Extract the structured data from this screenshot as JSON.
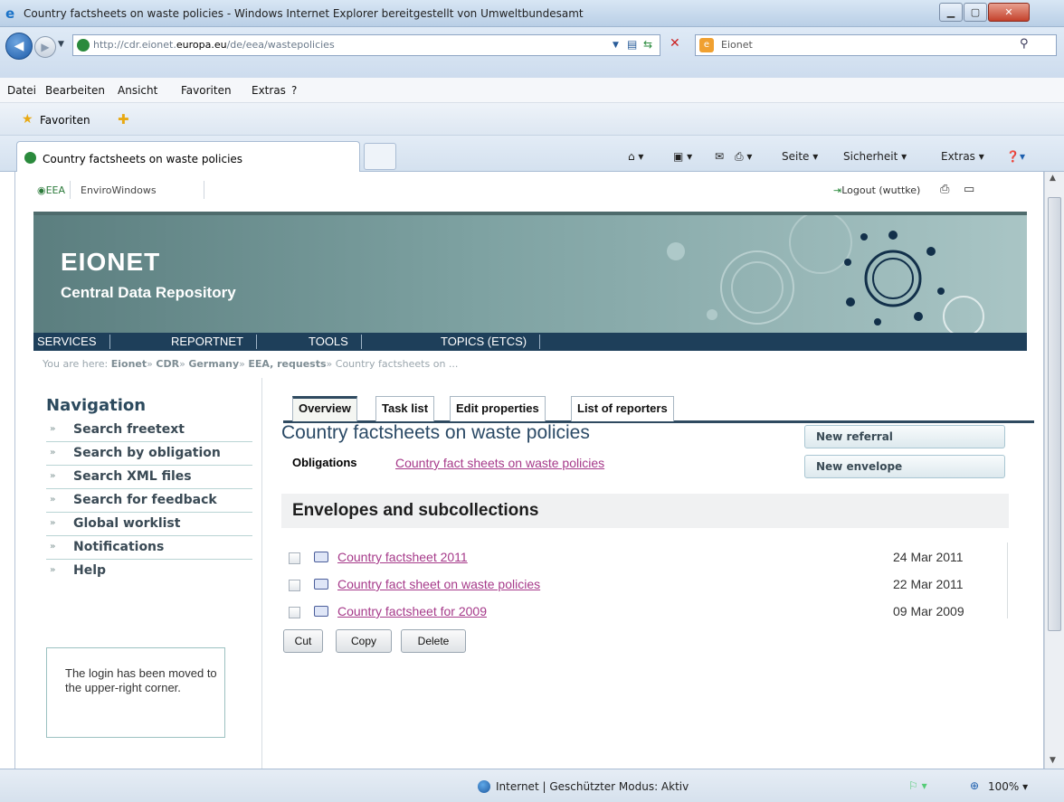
{
  "window": {
    "title": "Country factsheets on waste policies - Windows Internet Explorer bereitgestellt von Umweltbundesamt"
  },
  "address": {
    "url_prefix": "http://cdr.eionet.",
    "url_domain": "europa.eu",
    "url_path": "/de/eea/wastepolicies",
    "search_provider": "Eionet"
  },
  "menu": [
    "Datei",
    "Bearbeiten",
    "Ansicht",
    "Favoriten",
    "Extras",
    "?"
  ],
  "favorites_label": "Favoriten",
  "tab": {
    "label": "Country factsheets on waste policies"
  },
  "commandbar": {
    "page": "Seite",
    "security": "Sicherheit",
    "tools": "Extras"
  },
  "site": {
    "eea": "EEA",
    "envirowindows": "EnviroWindows",
    "logout": "Logout (wuttke)",
    "brand": "EIONET",
    "brand_sub": "Central Data Repository",
    "topnav": [
      "SERVICES",
      "REPORTNET",
      "TOOLS",
      "TOPICS (ETCS)"
    ],
    "breadcrumb_prefix": "You are here:",
    "breadcrumb": [
      "Eionet",
      "CDR",
      "Germany",
      "EEA, requests"
    ],
    "breadcrumb_current": "Country factsheets on ..."
  },
  "navigation": {
    "title": "Navigation",
    "items": [
      "Search freetext",
      "Search by obligation",
      "Search XML files",
      "Search for feedback",
      "Global worklist",
      "Notifications",
      "Help"
    ],
    "login_note": "The login has been moved to the upper-right corner."
  },
  "main": {
    "tabs": [
      "Overview",
      "Task list",
      "Edit properties",
      "List of reporters"
    ],
    "title": "Country factsheets on waste policies",
    "obligations_label": "Obligations",
    "obligation_link": "Country fact sheets on waste policies",
    "buttons": {
      "new_referral": "New referral",
      "new_envelope": "New envelope"
    },
    "section_title": "Envelopes and subcollections",
    "envelopes": [
      {
        "name": "Country factsheet 2011",
        "date": "24 Mar 2011"
      },
      {
        "name": "Country fact sheet on waste policies",
        "date": "22 Mar 2011"
      },
      {
        "name": "Country factsheet for 2009",
        "date": "09 Mar 2009"
      }
    ],
    "actions": [
      "Cut",
      "Copy",
      "Delete"
    ]
  },
  "statusbar": {
    "zone": "Internet | Geschützter Modus: Aktiv",
    "zoom": "100%"
  },
  "colors": {
    "link": "#a63a8a",
    "banner": "#7ea2a2",
    "navstrip": "#1e3f5a",
    "title": "#2b4a66"
  }
}
